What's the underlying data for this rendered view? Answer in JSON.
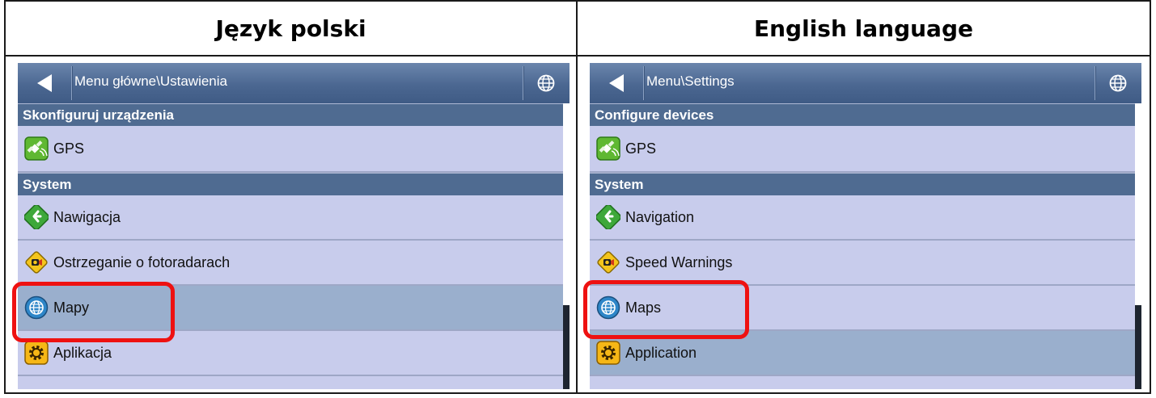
{
  "headers": {
    "left": "Język polski",
    "right": "English language"
  },
  "left_panel": {
    "breadcrumb": "Menu główne\\Ustawienia",
    "sections": [
      {
        "title": "Skonfiguruj urządzenia",
        "items": [
          "GPS"
        ]
      },
      {
        "title": "System",
        "items": [
          "Nawigacja",
          "Ostrzeganie o fotoradarach",
          "Mapy",
          "Aplikacja"
        ]
      }
    ],
    "selected": "Mapy",
    "highlighted": "Mapy"
  },
  "right_panel": {
    "breadcrumb": "Menu\\Settings",
    "sections": [
      {
        "title": "Configure devices",
        "items": [
          "GPS"
        ]
      },
      {
        "title": "System",
        "items": [
          "Navigation",
          "Speed Warnings",
          "Maps",
          "Application"
        ]
      }
    ],
    "selected": "Application",
    "highlighted": "Maps"
  },
  "icons": {
    "back": "back-arrow-icon",
    "language": "globe-icon",
    "gps": "gps-satellite-icon",
    "navigation": "navigation-arrow-icon",
    "speed": "speed-camera-warning-icon",
    "maps": "globe-icon",
    "application": "gear-icon"
  },
  "colors": {
    "titlebar": "#4b6791",
    "section_header": "#4f6b91",
    "row": "#c8ccec",
    "row_selected": "#9aafcd",
    "highlight": "#ee1111"
  }
}
